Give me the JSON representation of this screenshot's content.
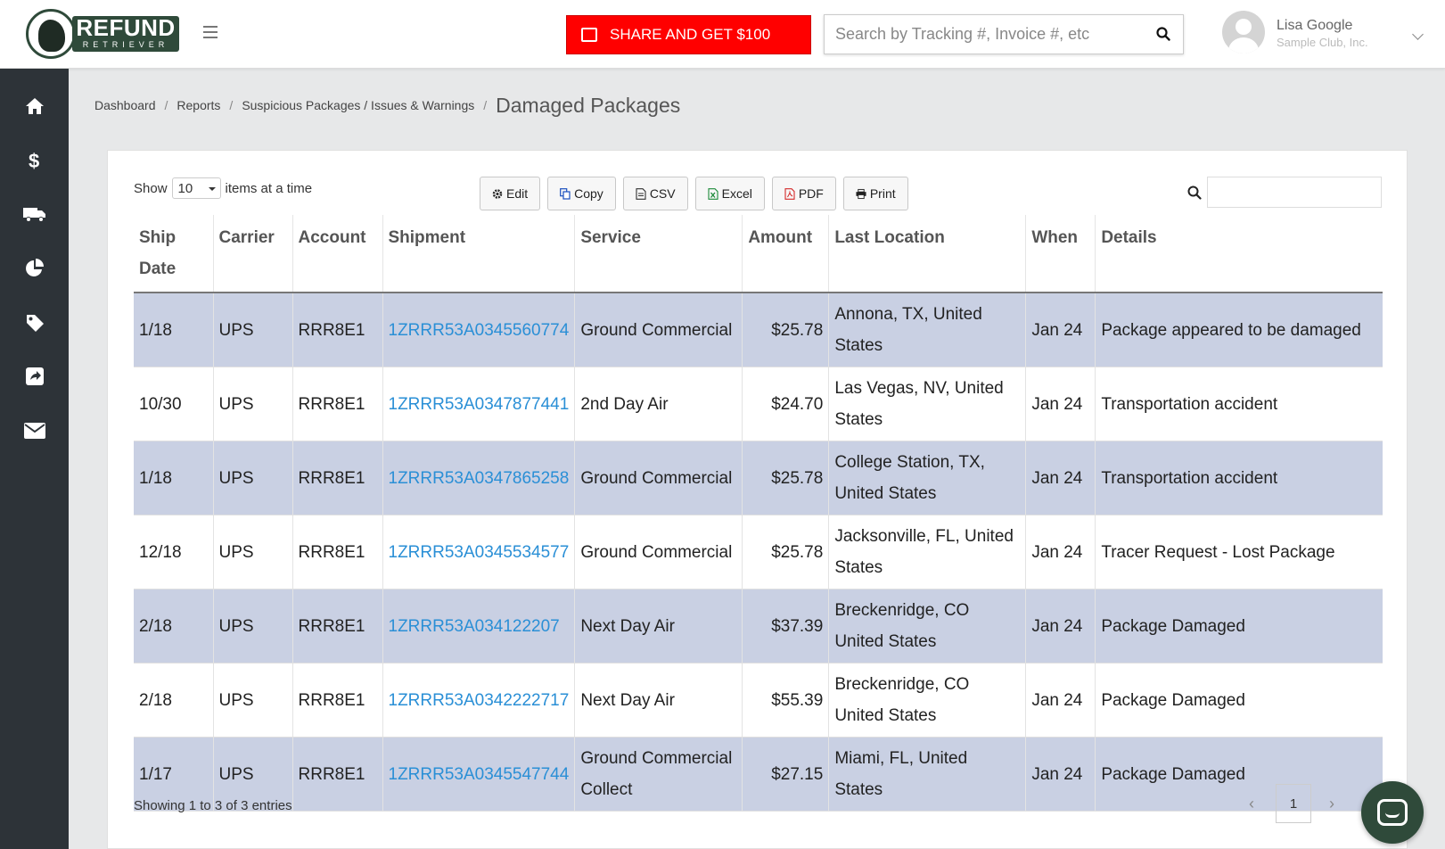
{
  "logo": {
    "line1": "REFUND",
    "line2": "RETRIEVER"
  },
  "header": {
    "share_label": "SHARE AND GET $100",
    "search_placeholder": "Search by Tracking #, Invoice #, etc",
    "user_name": "Lisa Google",
    "user_org": "Sample Club, Inc."
  },
  "sidebar": {
    "items": [
      {
        "icon": "home-icon"
      },
      {
        "icon": "dollar-icon"
      },
      {
        "icon": "truck-icon"
      },
      {
        "icon": "pie-chart-icon"
      },
      {
        "icon": "tag-icon"
      },
      {
        "icon": "share-icon"
      },
      {
        "icon": "envelope-icon"
      }
    ]
  },
  "breadcrumb": {
    "items": [
      "Dashboard",
      "Reports",
      "Suspicious Packages / Issues & Warnings"
    ],
    "current": "Damaged Packages"
  },
  "controls": {
    "show_label": "Show",
    "page_size": "10",
    "items_label": "items at a time",
    "buttons": [
      "Edit",
      "Copy",
      "CSV",
      "Excel",
      "PDF",
      "Print"
    ]
  },
  "table": {
    "headers": [
      "Ship Date",
      "Carrier",
      "Account",
      "Shipment",
      "Service",
      "Amount",
      "Last Location",
      "When",
      "Details"
    ],
    "rows": [
      [
        "1/18",
        "UPS",
        "RRR8E1",
        "1ZRRR53A0345560774",
        "Ground Commercial",
        "$25.78",
        "Annona, TX, United States",
        "Jan 24",
        "Package appeared to be damaged"
      ],
      [
        "10/30",
        "UPS",
        "RRR8E1",
        "1ZRRR53A0347877441",
        "2nd Day Air",
        "$24.70",
        "Las Vegas, NV, United States",
        "Jan 24",
        "Transportation accident"
      ],
      [
        "1/18",
        "UPS",
        "RRR8E1",
        "1ZRRR53A0347865258",
        "Ground Commercial",
        "$25.78",
        "College Station, TX, United States",
        "Jan 24",
        "Transportation accident"
      ],
      [
        "12/18",
        "UPS",
        "RRR8E1",
        "1ZRRR53A0345534577",
        "Ground Commercial",
        "$25.78",
        "Jacksonville, FL, United States",
        "Jan 24",
        "Tracer Request - Lost Package"
      ],
      [
        "2/18",
        "UPS",
        "RRR8E1",
        "1ZRRR53A034122207",
        "Next Day Air",
        "$37.39",
        "Breckenridge, CO United States",
        "Jan 24",
        "Package Damaged"
      ],
      [
        "2/18",
        "UPS",
        "RRR8E1",
        "1ZRRR53A0342222717",
        "Next Day Air",
        "$55.39",
        "Breckenridge, CO United States",
        "Jan 24",
        "Package Damaged"
      ],
      [
        "1/17",
        "UPS",
        "RRR8E1",
        "1ZRRR53A0345547744",
        "Ground Commercial Collect",
        "$27.15",
        "Miami, FL, United States",
        "Jan 24",
        "Package Damaged"
      ]
    ]
  },
  "footer": {
    "summary": "Showing 1 to 3 of 3 entries",
    "page": "1",
    "prev": "‹",
    "next": "›"
  },
  "colors": {
    "accent_red": "#ff0000",
    "sidebar": "#2d3338",
    "brand_green": "#2f4a3a",
    "row_stripe": "#c9d0e3",
    "link": "#2a8fd6"
  }
}
